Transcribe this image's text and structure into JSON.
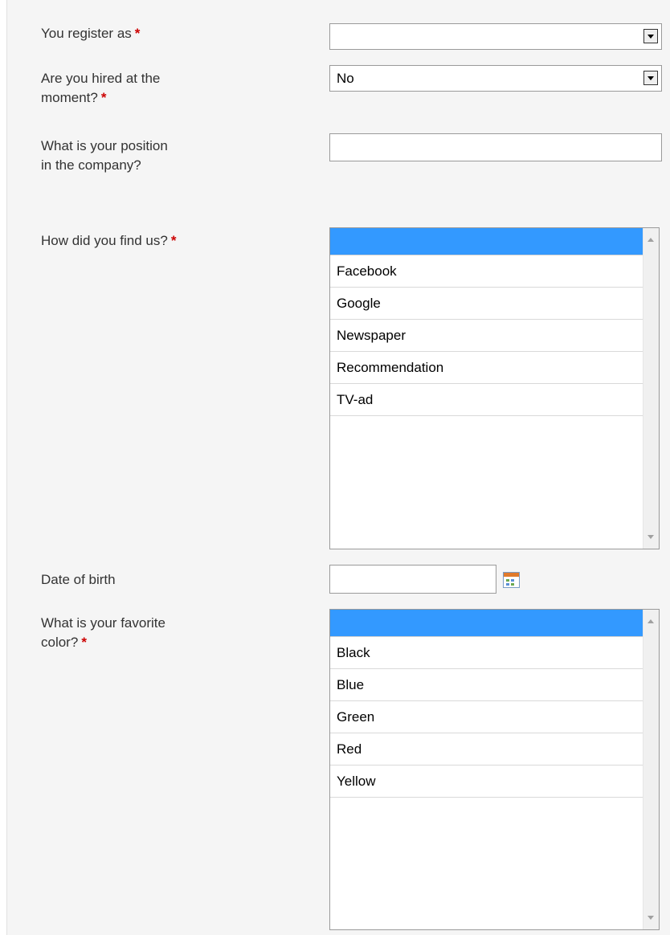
{
  "required_mark": "*",
  "fields": {
    "register_as": {
      "label": "You register as",
      "value": ""
    },
    "hired": {
      "label": "Are you hired at the moment?",
      "value": "No"
    },
    "position": {
      "label": "What is your position in the company?",
      "value": ""
    },
    "find_us": {
      "label": "How did you find us?",
      "options": [
        "",
        "Facebook",
        "Google",
        "Newspaper",
        "Recommendation",
        "TV-ad"
      ]
    },
    "dob": {
      "label": "Date of birth",
      "value": ""
    },
    "color": {
      "label": "What is your favorite color?",
      "options": [
        "",
        "Black",
        "Blue",
        "Green",
        "Red",
        "Yellow"
      ]
    }
  },
  "icons": {
    "select_arrow": "chevron-down-icon",
    "calendar": "calendar-icon",
    "scroll_up": "scroll-up-arrow",
    "scroll_down": "scroll-down-arrow"
  },
  "colors": {
    "selection": "#3399ff",
    "required": "#cc0000",
    "panel_background": "#f5f5f5"
  }
}
